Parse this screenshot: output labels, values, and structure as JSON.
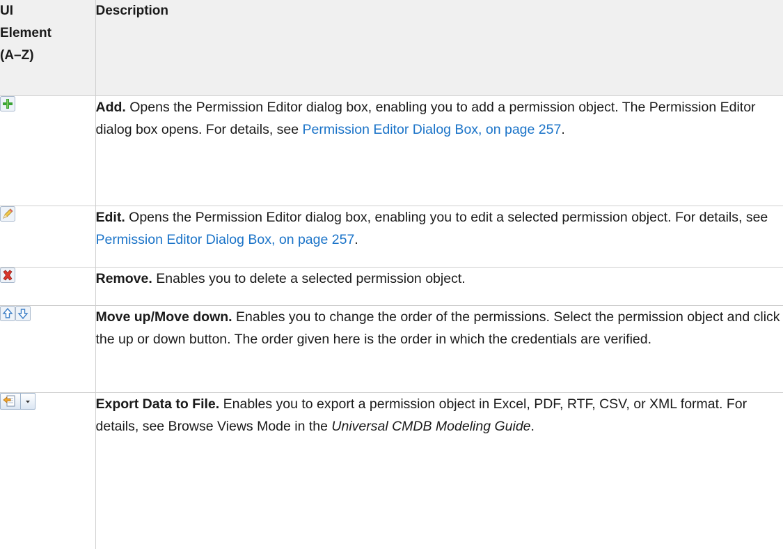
{
  "header": {
    "col1_line1": "UI",
    "col1_line2": "Element",
    "col1_line3": "(A–Z)",
    "col2": "Description"
  },
  "rows": [
    {
      "icon": "add-icon",
      "title": "Add.",
      "text": " Opens the Permission Editor dialog box, enabling you to add a permission object. The Permission Editor dialog box opens. For details, see ",
      "link": "Permission Editor Dialog Box, on page 257",
      "after": "."
    },
    {
      "icon": "edit-pencil-icon",
      "title": "Edit.",
      "text": " Opens the Permission Editor dialog box, enabling you to edit a selected permission object. For details, see ",
      "link": "Permission Editor Dialog Box, on page 257",
      "after": "."
    },
    {
      "icon": "remove-x-icon",
      "title": "Remove.",
      "text": " Enables you to delete a selected permission object."
    },
    {
      "icon": "move-up-down-icons",
      "title": "Move up/Move down.",
      "text": " Enables you to change the order of the permissions. Select the permission object and click the up or down button. The order given here is the order in which the credentials are verified."
    },
    {
      "icon": "export-data-icon",
      "title": "Export Data to File.",
      "text": " Enables you to export a permission object in Excel, PDF, RTF, CSV, or XML format. For details, see Browse Views Mode in the ",
      "italic": "Universal CMDB Modeling Guide",
      "after": "."
    }
  ],
  "colors": {
    "link": "#1a73c8",
    "header_bg": "#f0f0f0",
    "border": "#cfcfcf"
  }
}
